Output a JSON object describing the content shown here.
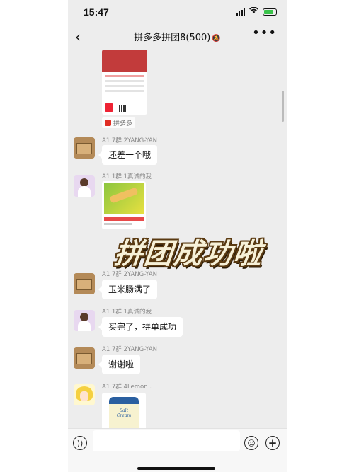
{
  "status_bar": {
    "time": "15:47",
    "icons": [
      "signal-icon",
      "wifi-icon",
      "battery-charging-icon"
    ]
  },
  "nav": {
    "title": "拼多多拼团8(500)",
    "mute_icon": "bell-mute-icon",
    "back_icon": "back-chevron-icon",
    "more_icon": "more-dots-icon"
  },
  "chat": {
    "share_tag": "拼多多",
    "messages": [
      {
        "sender": "A1 7群 2YANG-YAN",
        "text": "还差一个哦",
        "avatar": "box-avatar"
      },
      {
        "sender": "A1 1群 1真诚的我",
        "type": "image",
        "avatar": "girl-avatar"
      },
      {
        "sender": "A1 7群 2YANG-YAN",
        "text": "玉米肠满了",
        "avatar": "box-avatar"
      },
      {
        "sender": "A1 1群 1真诚的我",
        "text": "买完了，拼单成功",
        "avatar": "girl-avatar"
      },
      {
        "sender": "A1 7群 2YANG-YAN",
        "text": "谢谢啦",
        "avatar": "box-avatar"
      },
      {
        "sender": "A1 7群 4Lemon .",
        "type": "image",
        "avatar": "anime-avatar"
      }
    ],
    "lotion_label": "Salt Cream"
  },
  "overlay_text": "拼团成功啦",
  "input_bar": {
    "placeholder": ""
  },
  "colors": {
    "chat_bg": "#ededed",
    "bubble": "#ffffff",
    "overlay_fill": "#f7f1d8",
    "overlay_stroke": "#5a3a12",
    "pdd_red": "#e02e24"
  }
}
